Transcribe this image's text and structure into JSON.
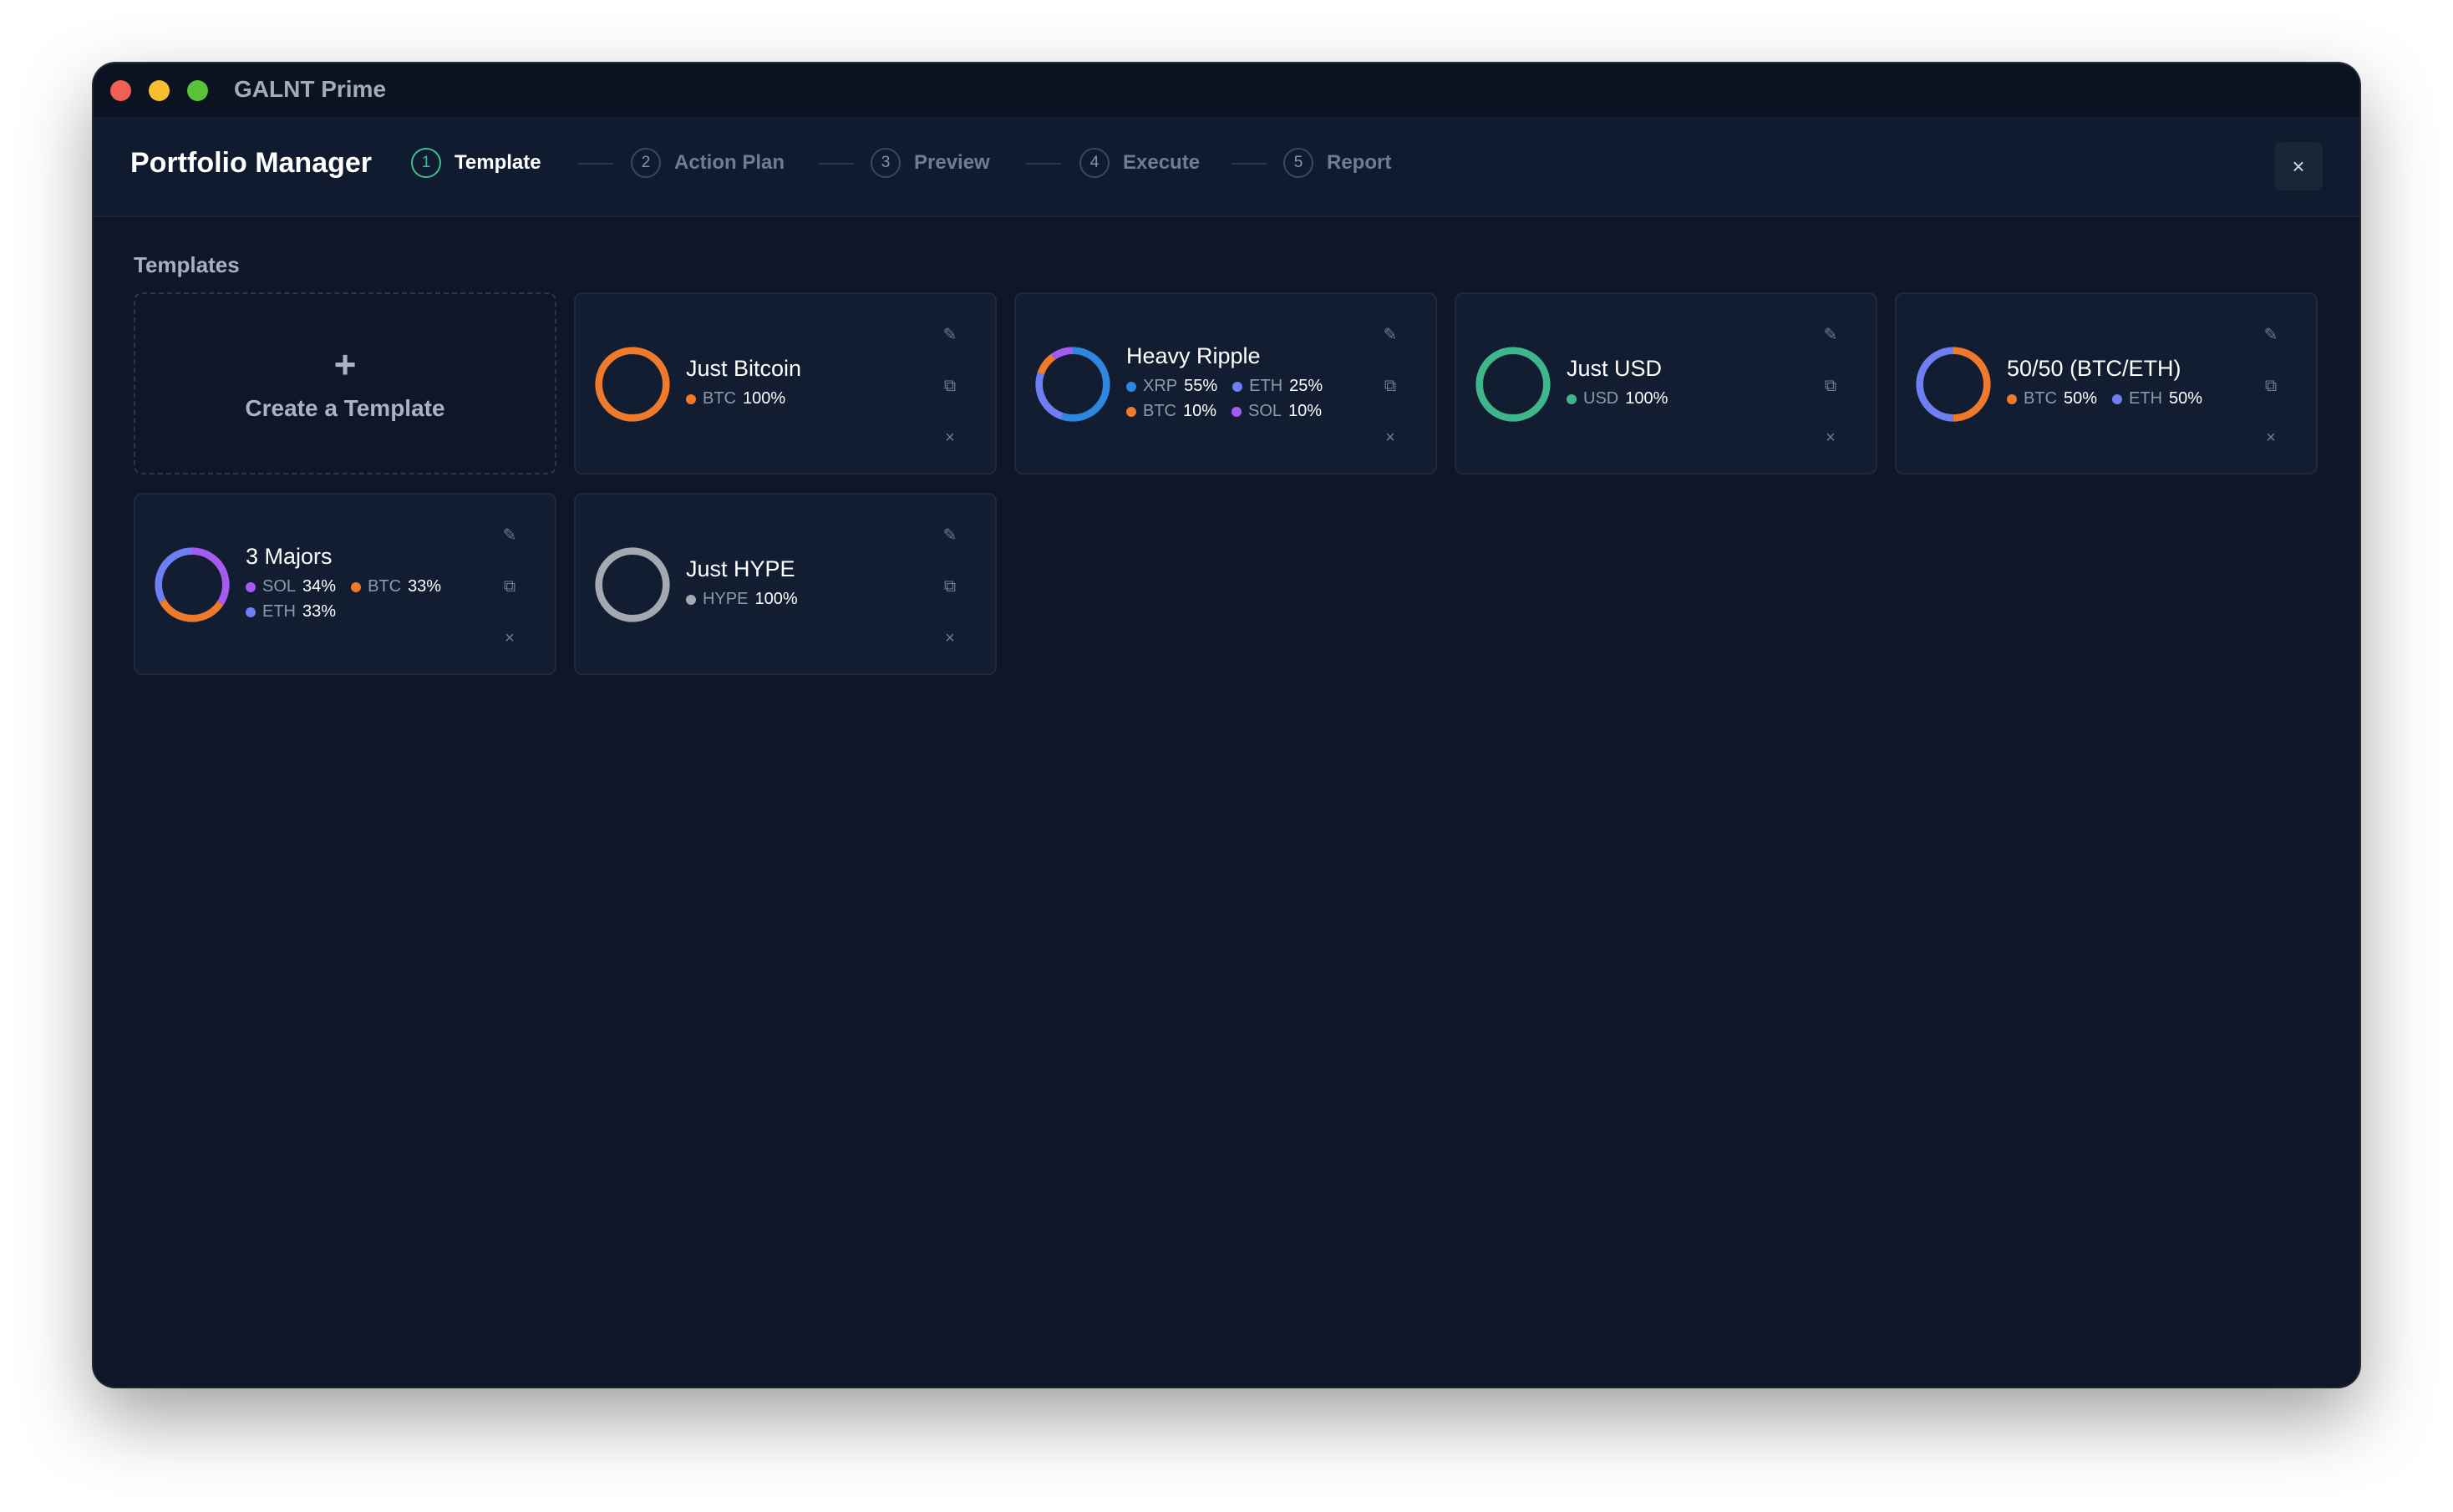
{
  "window": {
    "app_title": "GALNT Prime"
  },
  "header": {
    "title": "Portfolio Manager",
    "close_label": "×",
    "steps": [
      {
        "num": "1",
        "label": "Template",
        "active": true
      },
      {
        "num": "2",
        "label": "Action Plan",
        "active": false
      },
      {
        "num": "3",
        "label": "Preview",
        "active": false
      },
      {
        "num": "4",
        "label": "Execute",
        "active": false
      },
      {
        "num": "5",
        "label": "Report",
        "active": false
      }
    ]
  },
  "main": {
    "section_label": "Templates",
    "create": {
      "plus": "+",
      "label": "Create a Template"
    },
    "icons": {
      "edit": "✎",
      "duplicate": "⧉",
      "delete": "×"
    },
    "templates": [
      {
        "name": "Just Bitcoin",
        "allocations": [
          {
            "symbol": "BTC",
            "percent": "100%",
            "value": 100,
            "color": "#f07a2c"
          }
        ]
      },
      {
        "name": "Heavy Ripple",
        "allocations": [
          {
            "symbol": "XRP",
            "percent": "55%",
            "value": 55,
            "color": "#2f86e0"
          },
          {
            "symbol": "ETH",
            "percent": "25%",
            "value": 25,
            "color": "#6d7ff2"
          },
          {
            "symbol": "BTC",
            "percent": "10%",
            "value": 10,
            "color": "#f07a2c"
          },
          {
            "symbol": "SOL",
            "percent": "10%",
            "value": 10,
            "color": "#a45bf0"
          }
        ]
      },
      {
        "name": "Just USD",
        "allocations": [
          {
            "symbol": "USD",
            "percent": "100%",
            "value": 100,
            "color": "#3fb68a"
          }
        ]
      },
      {
        "name": "50/50 (BTC/ETH)",
        "allocations": [
          {
            "symbol": "BTC",
            "percent": "50%",
            "value": 50,
            "color": "#f07a2c"
          },
          {
            "symbol": "ETH",
            "percent": "50%",
            "value": 50,
            "color": "#6d7ff2"
          }
        ]
      },
      {
        "name": "3 Majors",
        "allocations": [
          {
            "symbol": "SOL",
            "percent": "34%",
            "value": 34,
            "color": "#a45bf0"
          },
          {
            "symbol": "BTC",
            "percent": "33%",
            "value": 33,
            "color": "#f07a2c"
          },
          {
            "symbol": "ETH",
            "percent": "33%",
            "value": 33,
            "color": "#6d7ff2"
          }
        ]
      },
      {
        "name": "Just HYPE",
        "allocations": [
          {
            "symbol": "HYPE",
            "percent": "100%",
            "value": 100,
            "color": "#a3a8b1"
          }
        ]
      }
    ]
  }
}
